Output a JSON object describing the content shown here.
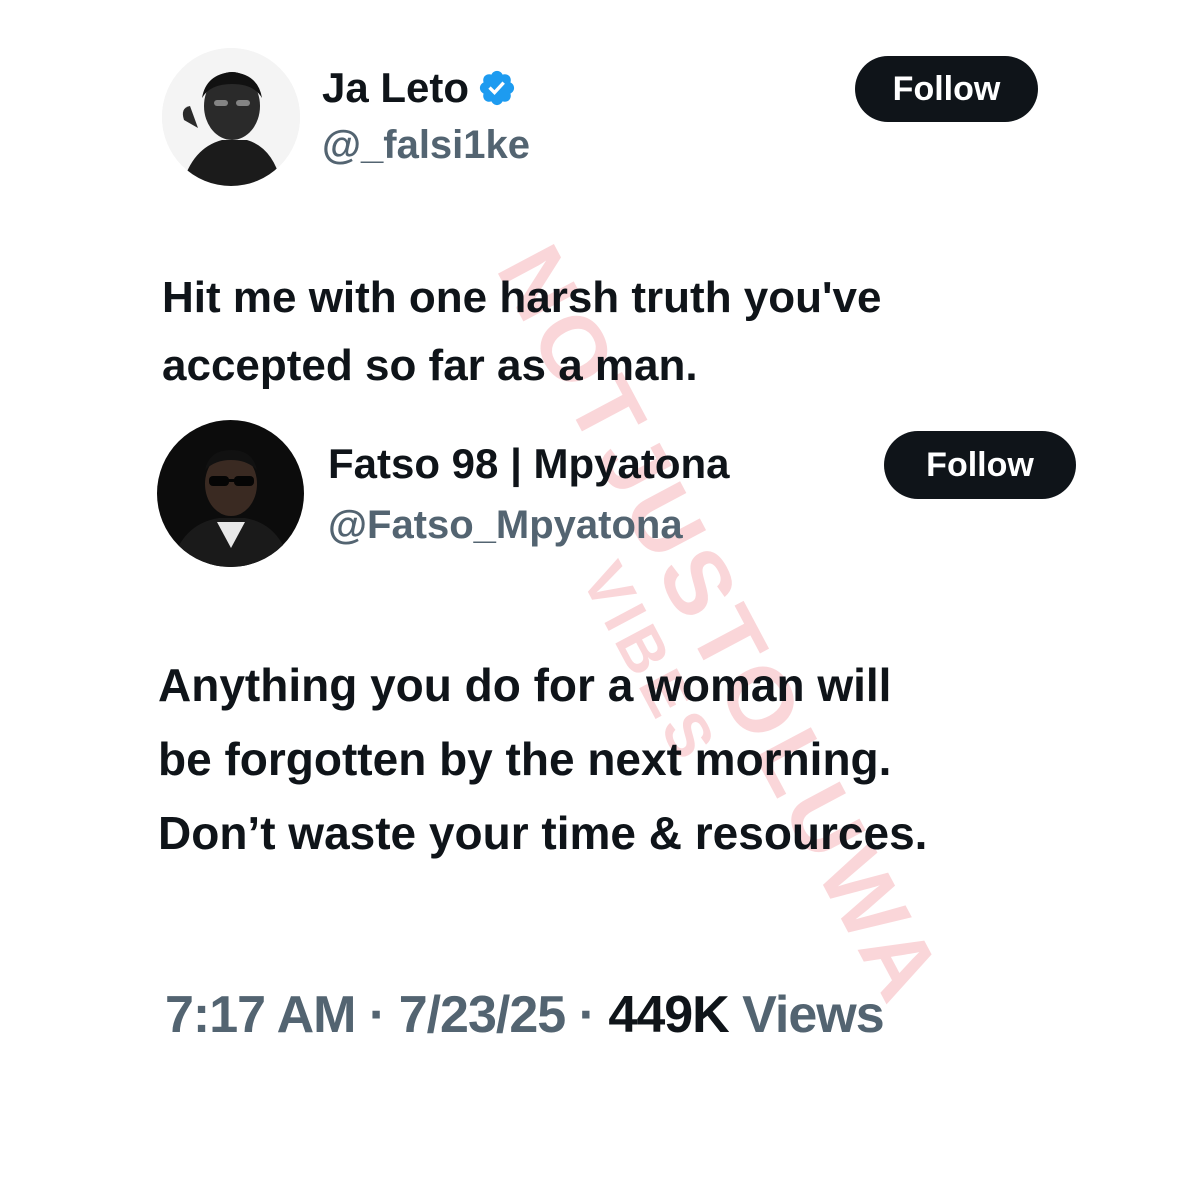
{
  "original_tweet": {
    "display_name": "Ja Leto",
    "handle": "@_falsi1ke",
    "verified_icon": "verified-badge-icon",
    "follow_label": "Follow",
    "text": "Hit me with one harsh truth you've\naccepted so far as a man."
  },
  "reply_tweet": {
    "display_name": "Fatso 98 | Mpyatona",
    "handle": "@Fatso_Mpyatona",
    "follow_label": "Follow",
    "text": "Anything you do for a woman will\nbe forgotten by the next morning.\nDon’t waste your time & resources."
  },
  "meta": {
    "time": "7:17 AM",
    "separator1": " · ",
    "date": "7/23/25",
    "separator2": " · ",
    "views_count": "449K",
    "views_label": " Views"
  },
  "watermark": {
    "line1": "NOTJUSTOLUWA",
    "line2": "VIBES"
  },
  "colors": {
    "verified_blue": "#1d9bf0",
    "follow_bg": "#0f1419",
    "secondary_text": "#536471",
    "watermark": "#e84650"
  }
}
